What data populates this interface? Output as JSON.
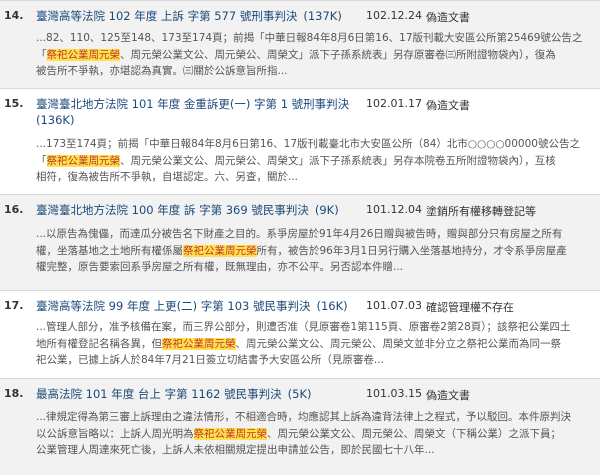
{
  "results": [
    {
      "num": "14.",
      "title": "臺灣高等法院 102 年度 上訴 字第 577 號刑事判決",
      "size": "(137K)",
      "date": "102.12.24",
      "reason": "偽造文書",
      "snippet": [
        [
          {
            "t": "...82、110、125至148、173至174頁；前揭「中華日報84年8月6日第16、17版刊載大安區公所第25469號公告之"
          }
        ],
        [
          {
            "t": "「"
          },
          {
            "t": "祭祀公業周元榮",
            "h": true
          },
          {
            "t": "、周元榮公業文公、周元榮公、周榮文」派下子孫系統表」另存原審卷㈢所附證物袋內），復為"
          }
        ],
        [
          {
            "t": "被告所不爭執，亦堪認為真實。㈢關於公訴意旨所指..."
          }
        ]
      ]
    },
    {
      "num": "15.",
      "title": "臺灣臺北地方法院 101 年度 金重訴更(一) 字第 1 號刑事判決",
      "size": "(136K)",
      "date": "102.01.17",
      "reason": "偽造文書",
      "snippet": [
        [
          {
            "t": "...173至174頁；前揭「中華日報84年8月6日第16、17版刊載臺北市大安區公所（84）北市○○○○00000號公告之"
          }
        ],
        [
          {
            "t": "「"
          },
          {
            "t": "祭祀公業周元榮",
            "h": true
          },
          {
            "t": "、周元榮公業文公、周元榮公、周榮文」派下子孫系統表」另存本院卷五所附證物袋內），互核"
          }
        ],
        [
          {
            "t": "相符，復為被告所不爭執，自堪認定。六、另查，關於..."
          }
        ]
      ]
    },
    {
      "num": "16.",
      "title": "臺灣臺北地方法院 100 年度 訴 字第 369 號民事判決",
      "size": "(9K)",
      "date": "101.12.04",
      "reason": "塗銷所有權移轉登記等",
      "snippet": [
        [
          {
            "t": "...以原告為傀儡，而達瓜分被告名下財產之目的。系爭房屋於91年4月26日贈與被告時，贈與部分只有房屋之所有"
          }
        ],
        [
          {
            "t": "權，坐落基地之土地所有權係屬"
          },
          {
            "t": "祭祀公業周元榮",
            "h": true
          },
          {
            "t": "所有，被告於96年3月1日另行購入坐落基地持分，才令系爭房屋產"
          }
        ],
        [
          {
            "t": "權完整，原告要索回系爭房屋之所有權，既無理由，亦不公平。另否認本件贈..."
          }
        ]
      ]
    },
    {
      "num": "17.",
      "title": "臺灣高等法院 99 年度 上更(二) 字第 103 號民事判決",
      "size": "(16K)",
      "date": "101.07.03",
      "reason": "確認管理權不存在",
      "snippet": [
        [
          {
            "t": "...管理人部分，准予核備在案，而三界公部分，則遭否准（見原審卷1第115頁、原審卷2第28頁）；該祭祀公業四土"
          }
        ],
        [
          {
            "t": "地所有權登記名稱各異，但"
          },
          {
            "t": "祭祀公業周元榮",
            "h": true
          },
          {
            "t": "、周元榮公業文公、周元榮公、周榮文並非分立之祭祀公業而為同一祭"
          }
        ],
        [
          {
            "t": "祀公業，已據上訴人於84年7月21日簽立切結書予大安區公所（見原審卷..."
          }
        ]
      ]
    },
    {
      "num": "18.",
      "title": "最高法院 101 年度 台上 字第 1162 號民事判決",
      "size": "(5K)",
      "date": "101.03.15",
      "reason": "偽造文書",
      "snippet": [
        [
          {
            "t": "...律規定得為第三審上訴理由之違法情形，不相適合時，均應認其上訴為違背法律上之程式，予以駁回。本件原判決"
          }
        ],
        [
          {
            "t": "以公訴意旨略以：上訴人周光明為"
          },
          {
            "t": "祭祀公業周元榮",
            "h": true
          },
          {
            "t": "、周元榮公業文公、周元榮公、周榮文（下稱公業）之派下員；"
          }
        ],
        [
          {
            "t": "公業管理人周達來死亡後，上訴人未依相關規定提出申請並公告，即於民國七十八年..."
          }
        ]
      ]
    }
  ]
}
